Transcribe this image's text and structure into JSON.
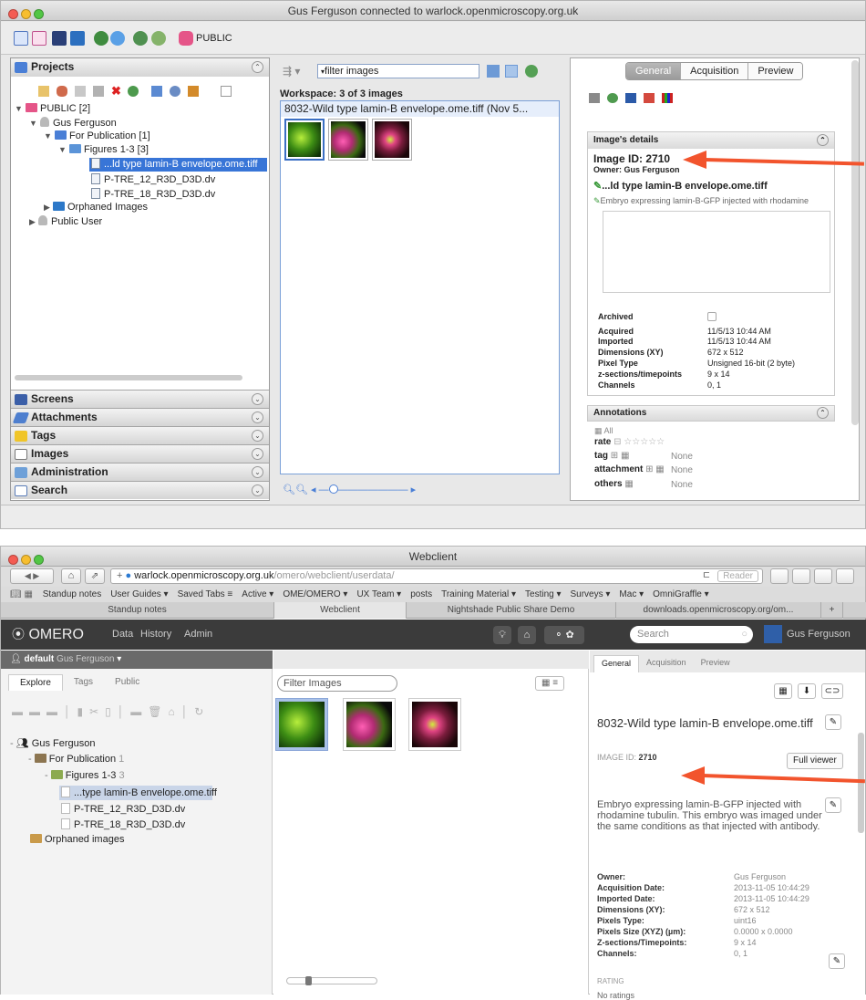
{
  "insight": {
    "window_title": "Gus Ferguson connected to warlock.openmicroscopy.org.uk",
    "toolbar": {
      "public_label": "PUBLIC"
    },
    "projects_header": "Projects",
    "tree": {
      "root": "PUBLIC [2]",
      "user": "Gus Ferguson",
      "project": "For Publication [1]",
      "dataset": "Figures 1-3 [3]",
      "images": [
        "...ld type lamin-B envelope.ome.tiff",
        "P-TRE_12_R3D_D3D.dv",
        "P-TRE_18_R3D_D3D.dv"
      ],
      "orphaned": "Orphaned Images",
      "public_user": "Public User"
    },
    "accordion": [
      "Screens",
      "Attachments",
      "Tags",
      "Images",
      "Administration",
      "Search"
    ],
    "filter_placeholder": "filter images",
    "workspace_label": "Workspace: 3 of 3 images",
    "image_title": "8032-Wild type lamin-B envelope.ome.tiff (Nov 5...",
    "tabs": [
      "General",
      "Acquisition",
      "Preview"
    ],
    "details_header": "Image's details",
    "image_id": "Image ID: 2710",
    "owner": "Owner: Gus Ferguson",
    "name": "...ld type lamin-B envelope.ome.tiff",
    "description": "Embryo expressing lamin-B-GFP injected with rhodamine",
    "details": [
      {
        "label": "Archived",
        "value": ""
      },
      {
        "label": "Acquired",
        "value": "11/5/13 10:44 AM"
      },
      {
        "label": "Imported",
        "value": "11/5/13 10:44 AM"
      },
      {
        "label": "Dimensions (XY)",
        "value": "672 x 512"
      },
      {
        "label": "Pixel Type",
        "value": "Unsigned 16-bit (2 byte)"
      },
      {
        "label": "z-sections/timepoints",
        "value": "9 x 14"
      },
      {
        "label": "Channels",
        "value": "0, 1"
      }
    ],
    "annotations_header": "Annotations",
    "annotations": {
      "all": "All",
      "rate": "rate",
      "tag": "tag",
      "attachment": "attachment",
      "others": "others",
      "none": "None"
    }
  },
  "webclient": {
    "window_title": "Webclient",
    "url_host": "warlock.openmicroscopy.org.uk",
    "url_path": "/omero/webclient/userdata/",
    "reader": "Reader",
    "bookmarks": [
      "Standup notes",
      "User Guides ▾",
      "Saved Tabs ≡",
      "Active ▾",
      "OME/OMERO ▾",
      "UX Team ▾",
      "posts",
      "Training Material ▾",
      "Testing ▾",
      "Surveys ▾",
      "Mac ▾",
      "OmniGraffle ▾"
    ],
    "tabs": [
      "Standup notes",
      "Webclient",
      "Nightshade Public Share Demo",
      "downloads.openmicroscopy.org/om..."
    ],
    "nav": {
      "logo": "OMERO",
      "data": "Data",
      "history": "History",
      "admin": "Admin",
      "search_placeholder": "Search",
      "user": "Gus Ferguson"
    },
    "group": "default",
    "group_user": "Gus Ferguson",
    "left_tabs": [
      "Explore",
      "Tags",
      "Public"
    ],
    "tree": {
      "user": "Gus Ferguson",
      "project": "For Publication",
      "project_count": "1",
      "dataset": "Figures 1-3",
      "dataset_count": "3",
      "images": [
        "...type lamin-B envelope.ome.tiff",
        "P-TRE_12_R3D_D3D.dv",
        "P-TRE_18_R3D_D3D.dv"
      ],
      "orphaned": "Orphaned images"
    },
    "filter_placeholder": "Filter Images",
    "right_tabs": [
      "General",
      "Acquisition",
      "Preview"
    ],
    "image_name": "8032-Wild type lamin-B envelope.ome.tiff",
    "image_id_label": "IMAGE ID:",
    "image_id": "2710",
    "full_viewer": "Full viewer",
    "description": "Embryo expressing lamin-B-GFP injected with rhodamine tubulin. This embryo was imaged under the same conditions as that injected with antibody.",
    "details": [
      {
        "label": "Owner:",
        "value": "Gus Ferguson"
      },
      {
        "label": "Acquisition Date:",
        "value": "2013-11-05 10:44:29"
      },
      {
        "label": "Imported Date:",
        "value": "2013-11-05 10:44:29"
      },
      {
        "label": "Dimensions (XY):",
        "value": "672 x 512"
      },
      {
        "label": "Pixels Type:",
        "value": "uint16"
      },
      {
        "label": "Pixels Size (XYZ) (µm):",
        "value": "0.0000 x 0.0000"
      },
      {
        "label": "Z-sections/Timepoints:",
        "value": "9 x 14"
      },
      {
        "label": "Channels:",
        "value": "0, 1"
      }
    ],
    "rating_header": "RATING",
    "rating_value": "No ratings"
  },
  "colors": {
    "arrow": "#f2542d",
    "selection": "#3875d7",
    "omero_bar": "#3b3b3b"
  }
}
